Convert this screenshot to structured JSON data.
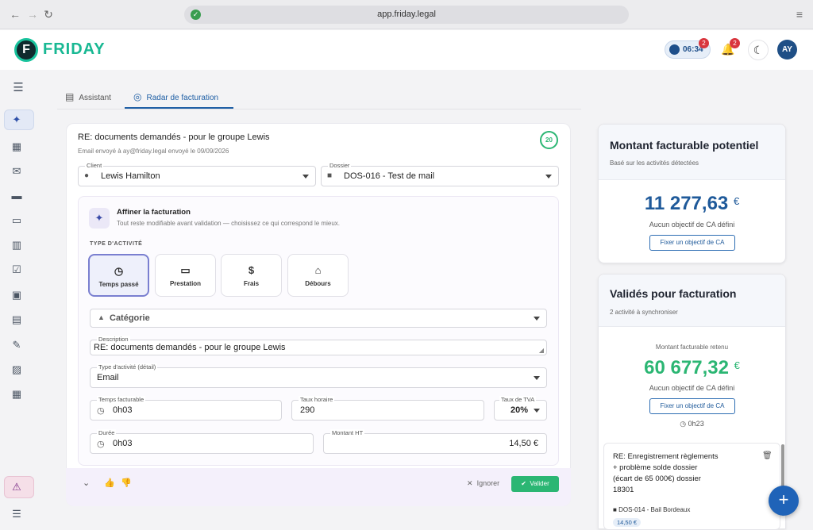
{
  "browser": {
    "url": "app.friday.legal"
  },
  "app": {
    "brand": "FRIDAY",
    "logo_letter": "F",
    "timer": "06:34",
    "timer_badge": "2",
    "notif_badge": "2",
    "avatar": "AY"
  },
  "tabs": [
    {
      "label": "Assistant"
    },
    {
      "label": "Radar de facturation"
    }
  ],
  "email": {
    "title": "RE: documents demandés - pour le groupe Lewis",
    "subtitle": "Email envoyé à ay@friday.legal envoyé le 09/09/2026",
    "score": "20"
  },
  "client": {
    "label": "Client",
    "value": "Lewis Hamilton"
  },
  "dossier": {
    "label": "Dossier",
    "value": "DOS-016 - Test de mail"
  },
  "refine": {
    "title": "Affiner la facturation",
    "subtitle": "Tout reste modifiable avant validation — choisissez ce qui correspond le mieux.",
    "type_label": "TYPE D'ACTIVITÉ",
    "types": [
      "Temps passé",
      "Prestation",
      "Frais",
      "Débours"
    ],
    "category_placeholder": "Catégorie",
    "description_label": "Description",
    "description_value": "RE: documents demandés - pour le groupe Lewis",
    "type_detail_label": "Type d'activité (détail)",
    "type_detail_value": "Email",
    "billable_label": "Temps facturable",
    "billable_value": "0h03",
    "rate_label": "Taux horaire",
    "rate_value": "290",
    "vat_label": "Taux de TVA",
    "vat_value": "20%",
    "duration_label": "Durée",
    "duration_value": "0h03",
    "amount_label": "Montant HT",
    "amount_value": "14,50  €"
  },
  "actions": {
    "ignore": "Ignorer",
    "validate": "Valider"
  },
  "potential": {
    "title": "Montant facturable potentiel",
    "subtitle": "Basé sur les activités détectées",
    "amount": "11 277,63",
    "currency": "€",
    "no_target": "Aucun objectif de CA défini",
    "set_target": "Fixer un objectif de CA"
  },
  "validated": {
    "title": "Validés pour facturation",
    "subtitle": "2 activité à synchroniser",
    "retained_label": "Montant facturable retenu",
    "amount": "60 677,32",
    "currency": "€",
    "no_target": "Aucun objectif de CA défini",
    "set_target": "Fixer un objectif de CA",
    "time": "0h23"
  },
  "item": {
    "title_l1": "RE: Enregistrement règlements",
    "title_l2": "+ problème solde dossier",
    "title_l3": "(écart de 65 000€) dossier",
    "title_l4": "18301",
    "dossier": "DOS-014 - Bail Bordeaux",
    "amount": "14,50 €"
  },
  "colors": {
    "accent": "#1f5fa5",
    "green": "#2bb673",
    "brand": "#18b893"
  }
}
